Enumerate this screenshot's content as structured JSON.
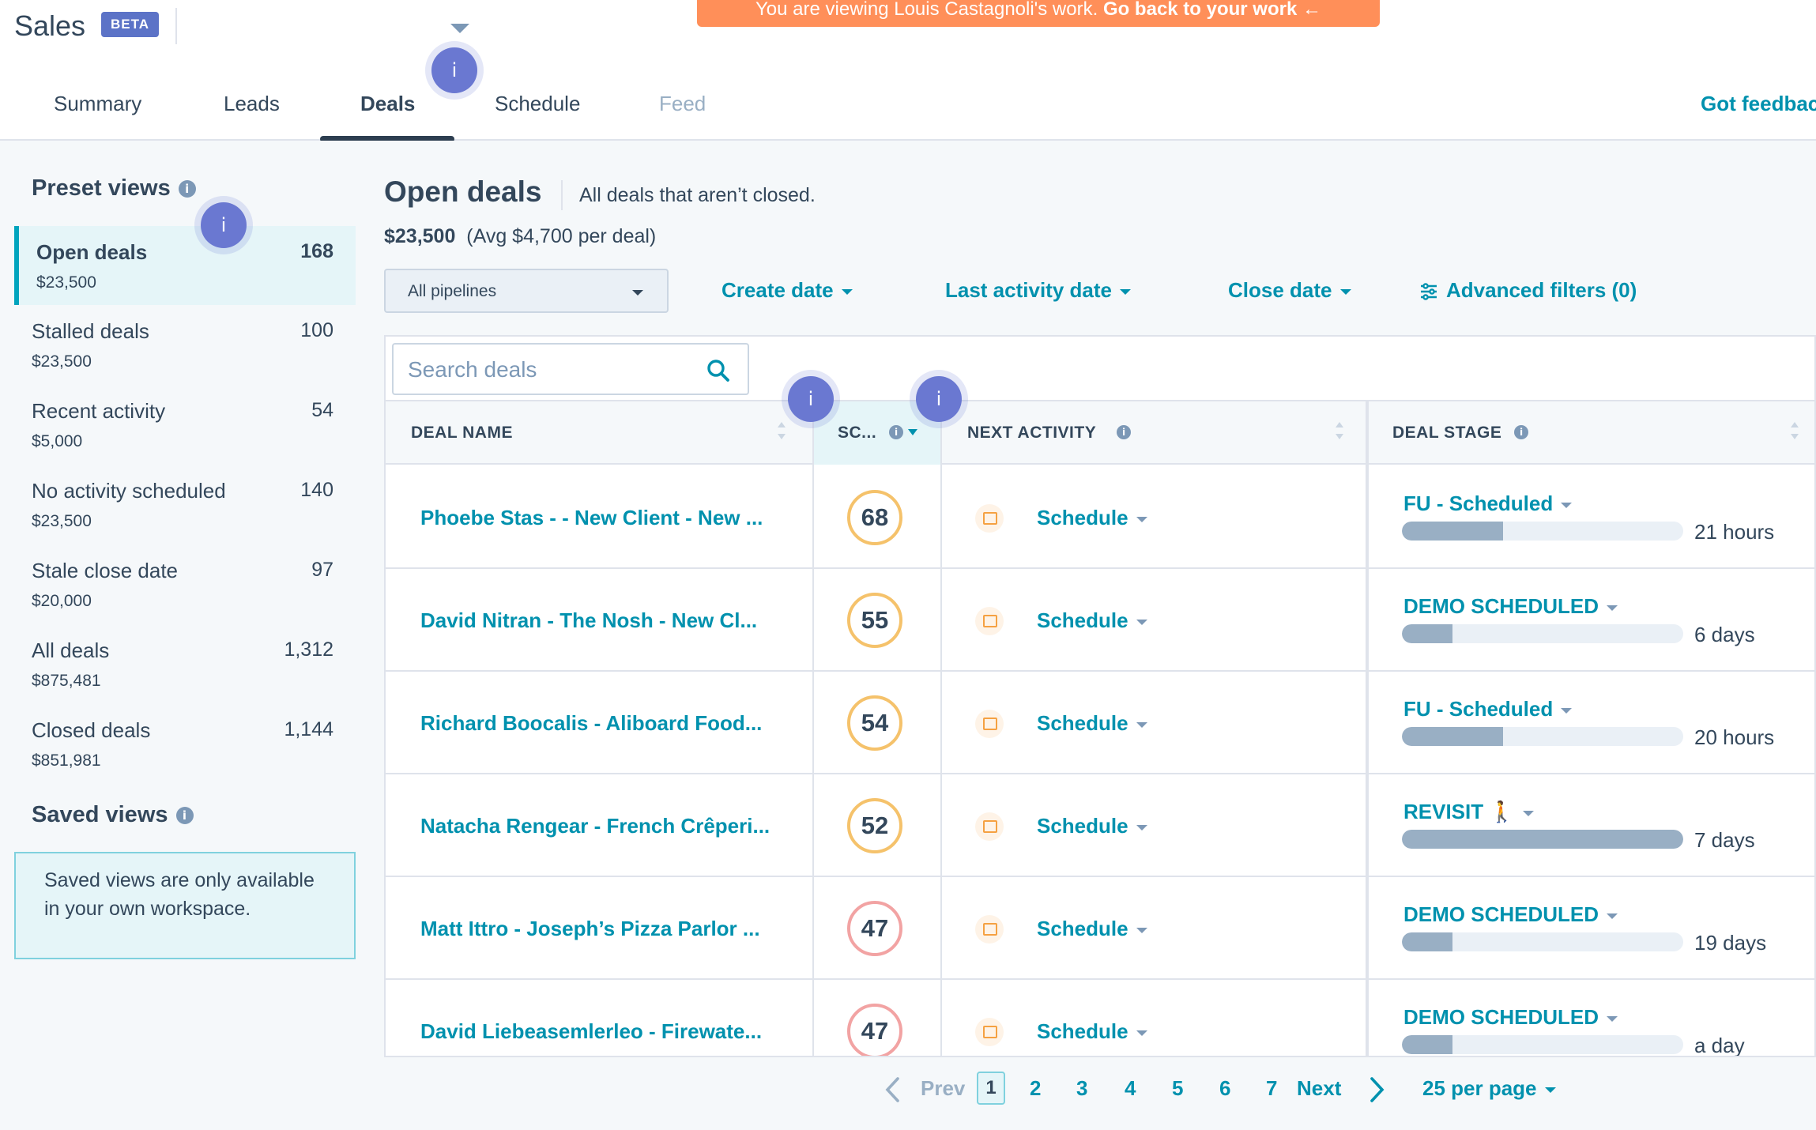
{
  "app": {
    "title": "Sales",
    "badge": "BETA"
  },
  "banner": {
    "text": "You are viewing Louis Castagnoli's work.",
    "action": "Go back to your work ←"
  },
  "tabs": [
    {
      "label": "Summary"
    },
    {
      "label": "Leads"
    },
    {
      "label": "Deals"
    },
    {
      "label": "Schedule"
    },
    {
      "label": "Feed"
    }
  ],
  "feedback_label": "Got feedback",
  "beacon_label": "i",
  "sidebar": {
    "preset_heading": "Preset views",
    "views": [
      {
        "name": "Open deals",
        "count": "168",
        "amount": "$23,500"
      },
      {
        "name": "Stalled deals",
        "count": "100",
        "amount": "$23,500"
      },
      {
        "name": "Recent activity",
        "count": "54",
        "amount": "$5,000"
      },
      {
        "name": "No activity scheduled",
        "count": "140",
        "amount": "$23,500"
      },
      {
        "name": "Stale close date",
        "count": "97",
        "amount": "$20,000"
      },
      {
        "name": "All deals",
        "count": "1,312",
        "amount": "$875,481"
      },
      {
        "name": "Closed deals",
        "count": "1,144",
        "amount": "$851,981"
      }
    ],
    "saved_heading": "Saved views",
    "saved_note": "Saved views are only available in your own workspace."
  },
  "main": {
    "title": "Open deals",
    "subtitle": "All deals that aren’t closed.",
    "total": "$23,500",
    "avg": "(Avg $4,700 per deal)",
    "pipeline": "All pipelines",
    "filters": {
      "create_date": "Create date",
      "last_activity": "Last activity date",
      "close_date": "Close date",
      "advanced": "Advanced filters (0)"
    },
    "search_placeholder": "Search deals"
  },
  "table": {
    "headers": {
      "deal_name": "DEAL NAME",
      "score": "SC...",
      "next_activity": "NEXT ACTIVITY",
      "deal_stage": "DEAL STAGE"
    },
    "rows": [
      {
        "name": "Phoebe Stas - - New Client - New ...",
        "score": "68",
        "activity": "Schedule",
        "stage": "FU - Scheduled",
        "progress": 0.36,
        "age": "21 hours"
      },
      {
        "name": "David Nitran - The Nosh - New Cl...",
        "score": "55",
        "activity": "Schedule",
        "stage": "DEMO SCHEDULED",
        "progress": 0.18,
        "age": "6 days"
      },
      {
        "name": "Richard Boocalis - Aliboard Food...",
        "score": "54",
        "activity": "Schedule",
        "stage": "FU - Scheduled",
        "progress": 0.36,
        "age": "20 hours"
      },
      {
        "name": "Natacha Rengear - French Crêperi...",
        "score": "52",
        "activity": "Schedule",
        "stage": "REVISIT 🚶",
        "progress": 1.0,
        "age": "7 days"
      },
      {
        "name": "Matt Ittro - Joseph’s Pizza Parlor ...",
        "score": "47",
        "activity": "Schedule",
        "stage": "DEMO SCHEDULED",
        "progress": 0.18,
        "age": "19 days"
      },
      {
        "name": "David Liebeasemlerleo - Firewate...",
        "score": "47",
        "activity": "Schedule",
        "stage": "DEMO SCHEDULED",
        "progress": 0.18,
        "age": "a day"
      }
    ]
  },
  "pagination": {
    "prev": "Prev",
    "pages": [
      "1",
      "2",
      "3",
      "4",
      "5",
      "6",
      "7"
    ],
    "current": "1",
    "next": "Next",
    "per_page": "25 per page"
  },
  "colors": {
    "accent": "#0091ae",
    "banner": "#ff8f59",
    "beacon": "#6a78d1",
    "score_orange": "#f5c26b",
    "score_red": "#f2a3a3"
  }
}
